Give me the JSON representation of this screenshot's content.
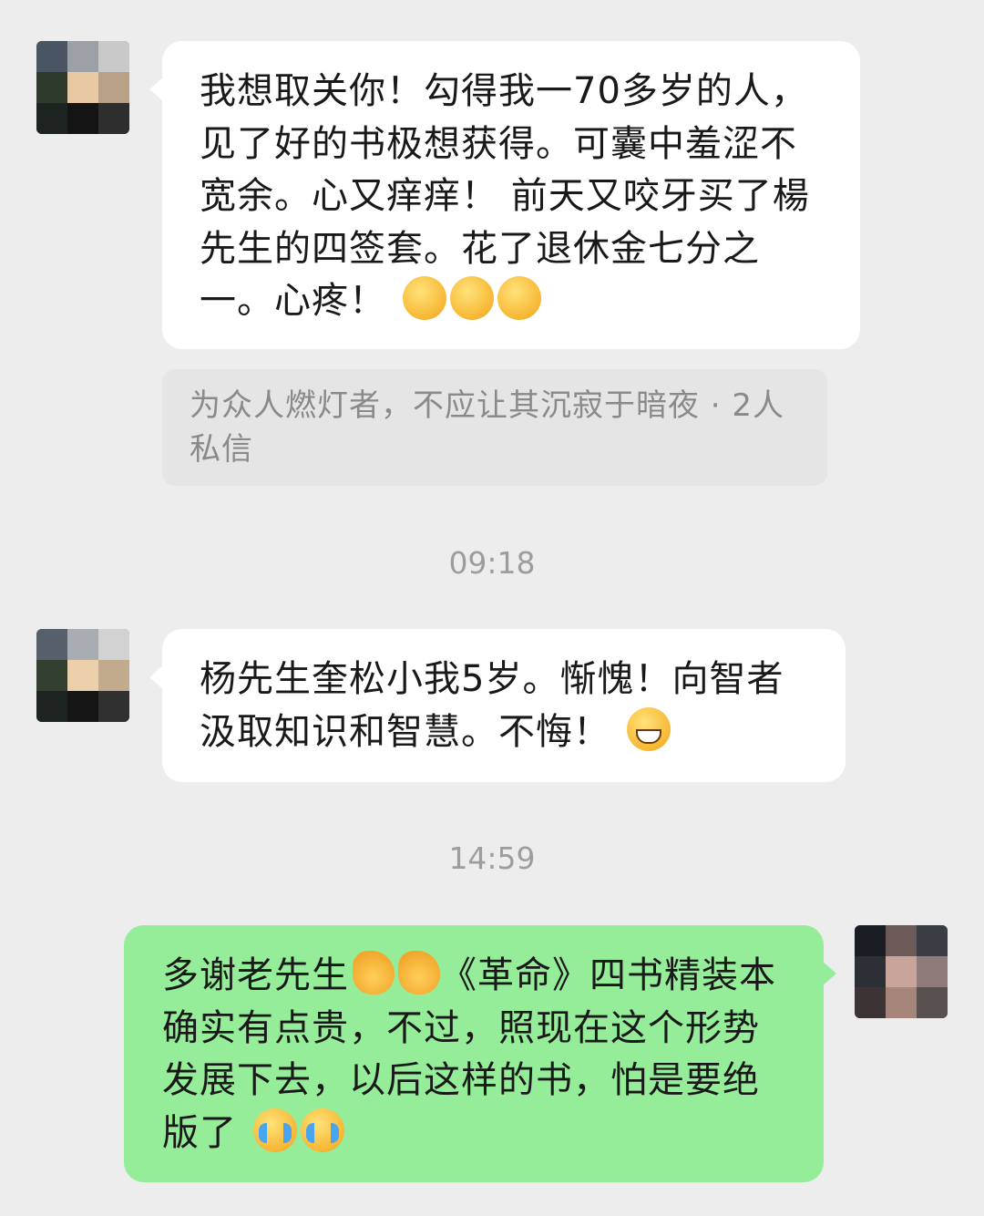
{
  "messages": [
    {
      "direction": "incoming",
      "text": "我想取关你！勾得我一70多岁的人，见了好的书极想获得。可囊中羞涩不宽余。心又痒痒！ 前天又咬牙买了楊先生的四签套。花了退休金七分之一。心疼！",
      "emojis": [
        "face-with-hand-over-mouth",
        "face-with-hand-over-mouth",
        "face-with-hand-over-mouth"
      ]
    },
    {
      "direction": "incoming",
      "text": "杨先生奎松小我5岁。惭愧！向智者汲取知识和智慧。不悔！",
      "emojis": [
        "grinning-face"
      ]
    },
    {
      "direction": "outgoing",
      "text_parts": [
        "多谢老先生",
        "《革命》四书精装本确实有点贵，不过，照现在这个形势发展下去，以后这样的书，怕是要绝版了"
      ],
      "inline_emojis": [
        "folded-hands",
        "folded-hands"
      ],
      "emojis": [
        "loudly-crying-face",
        "loudly-crying-face"
      ]
    }
  ],
  "quote": {
    "text": "为众人燃灯者，不应让其沉寂于暗夜 · 2人私信"
  },
  "timestamps": [
    "09:18",
    "14:59"
  ],
  "colors": {
    "background": "#ededed",
    "incoming_bubble": "#ffffff",
    "outgoing_bubble": "#95ec99",
    "quote_bubble": "#e5e5e5",
    "timestamp": "#9d9d9d"
  }
}
